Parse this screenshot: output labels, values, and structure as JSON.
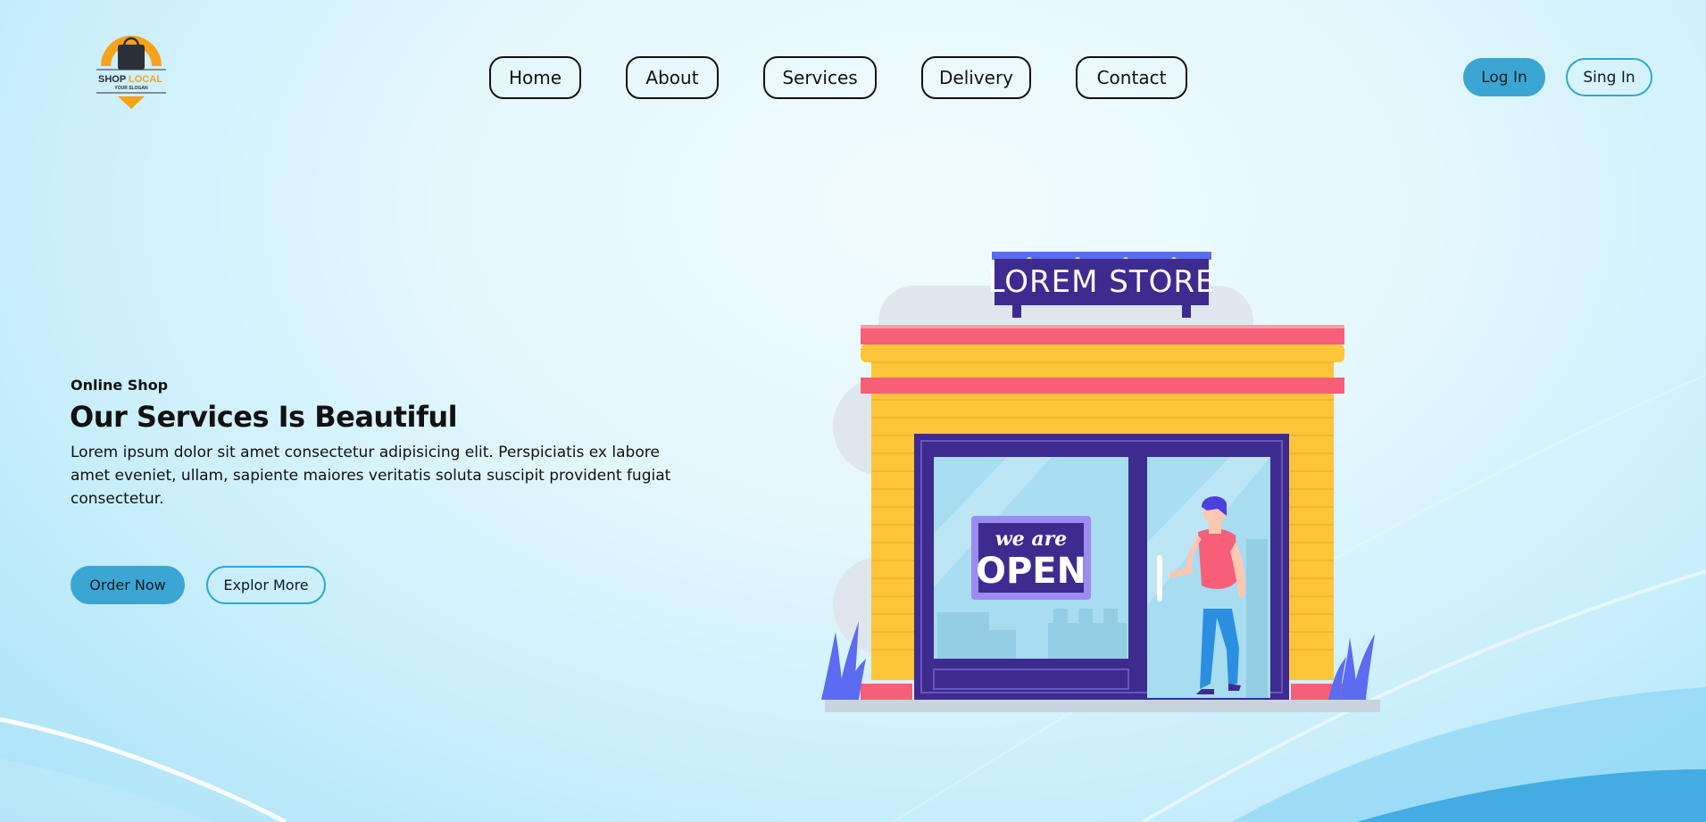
{
  "logo": {
    "brand_main": "SHOP ",
    "brand_accent": "LOCAL",
    "slogan": "YOUR SLOGAN"
  },
  "nav": {
    "items": [
      {
        "label": "Home"
      },
      {
        "label": "About"
      },
      {
        "label": "Services"
      },
      {
        "label": "Delivery"
      },
      {
        "label": "Contact"
      }
    ]
  },
  "auth": {
    "login_label": "Log In",
    "signin_label": "Sing In"
  },
  "hero": {
    "eyebrow": "Online Shop",
    "title": "Our Services Is Beautiful",
    "description": "Lorem ipsum dolor sit amet consectetur adipisicing elit. Perspiciatis ex labore amet eveniet, ullam, sapiente maiores veritatis soluta suscipit provident fugiat consectetur.",
    "primary_cta": "Order Now",
    "secondary_cta": "Explor More"
  },
  "illustration": {
    "store_sign": "LOREM STORE",
    "door_sign_line1": "we are",
    "door_sign_line2": "OPEN"
  },
  "colors": {
    "accent": "#3ba6d3",
    "accent_border": "#2ea8d4",
    "logo_orange": "#f7a21b",
    "store_purple": "#3d2a8c",
    "store_yellow": "#fcc53a",
    "store_pink": "#f75f78"
  }
}
